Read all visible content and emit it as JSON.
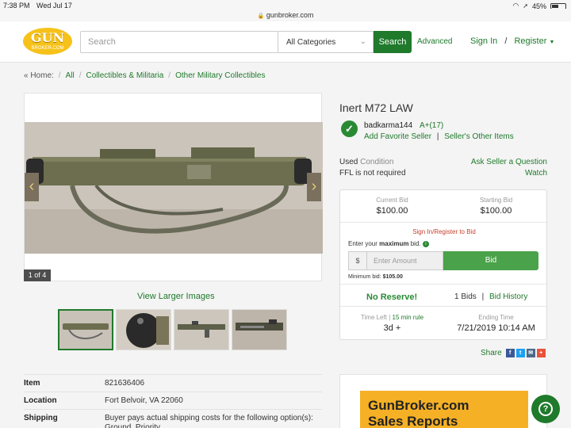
{
  "status_bar": {
    "time": "7:38 PM",
    "date": "Wed Jul 17",
    "url": "gunbroker.com",
    "battery": "45%"
  },
  "header": {
    "logo_line1": "GUN",
    "logo_line2": "BROKER.COM",
    "search_placeholder": "Search",
    "category_selected": "All Categories",
    "search_button": "Search",
    "advanced": "Advanced",
    "sign_in": "Sign In",
    "separator": "/",
    "register": "Register"
  },
  "breadcrumb": {
    "home": "« Home:",
    "all": "All",
    "collectibles": "Collectibles & Militaria",
    "other": "Other Military Collectibles",
    "sep": "/"
  },
  "gallery": {
    "counter": "1 of 4",
    "view_larger": "View Larger Images",
    "prev_arrow": "‹",
    "next_arrow": "›"
  },
  "item": {
    "title": "Inert M72 LAW",
    "seller_name": "badkarma144",
    "seller_rating": "A+(17)",
    "add_favorite": "Add Favorite Seller",
    "other_items": "Seller's Other Items",
    "condition_value": "Used",
    "condition_label": "Condition",
    "ffl": "FFL is not required",
    "ask_question": "Ask Seller a Question",
    "watch": "Watch"
  },
  "bid": {
    "current_bid_label": "Current Bid",
    "current_bid": "$100.00",
    "starting_bid_label": "Starting Bid",
    "starting_bid": "$100.00",
    "sign_in_register": "Sign In/Register to Bid",
    "enter_prefix": "Enter your",
    "enter_bold": "maximum",
    "enter_suffix": "bid.",
    "currency": "$",
    "amount_placeholder": "Enter Amount",
    "bid_button": "Bid",
    "min_bid_label": "Minimum bid:",
    "min_bid": "$105.00",
    "no_reserve": "No Reserve!",
    "bids_count": "1 Bids",
    "bids_sep": "|",
    "bid_history": "Bid History",
    "time_left_label": "Time Left",
    "rule_sep": "|",
    "min_rule": "15 min rule",
    "time_left": "3d +",
    "ending_time_label": "Ending Time",
    "ending_time": "7/21/2019 10:14 AM"
  },
  "share": {
    "label": "Share"
  },
  "details": {
    "rows": [
      {
        "k": "Item",
        "v": "821636406"
      },
      {
        "k": "Location",
        "v": "Fort Belvoir, VA 22060"
      },
      {
        "k": "Shipping",
        "v": "Buyer pays actual shipping costs for the following option(s): Ground, Priority"
      }
    ]
  },
  "ad": {
    "line1": "GunBroker.com",
    "line2": "Sales Reports"
  },
  "help": {
    "symbol": "?"
  }
}
